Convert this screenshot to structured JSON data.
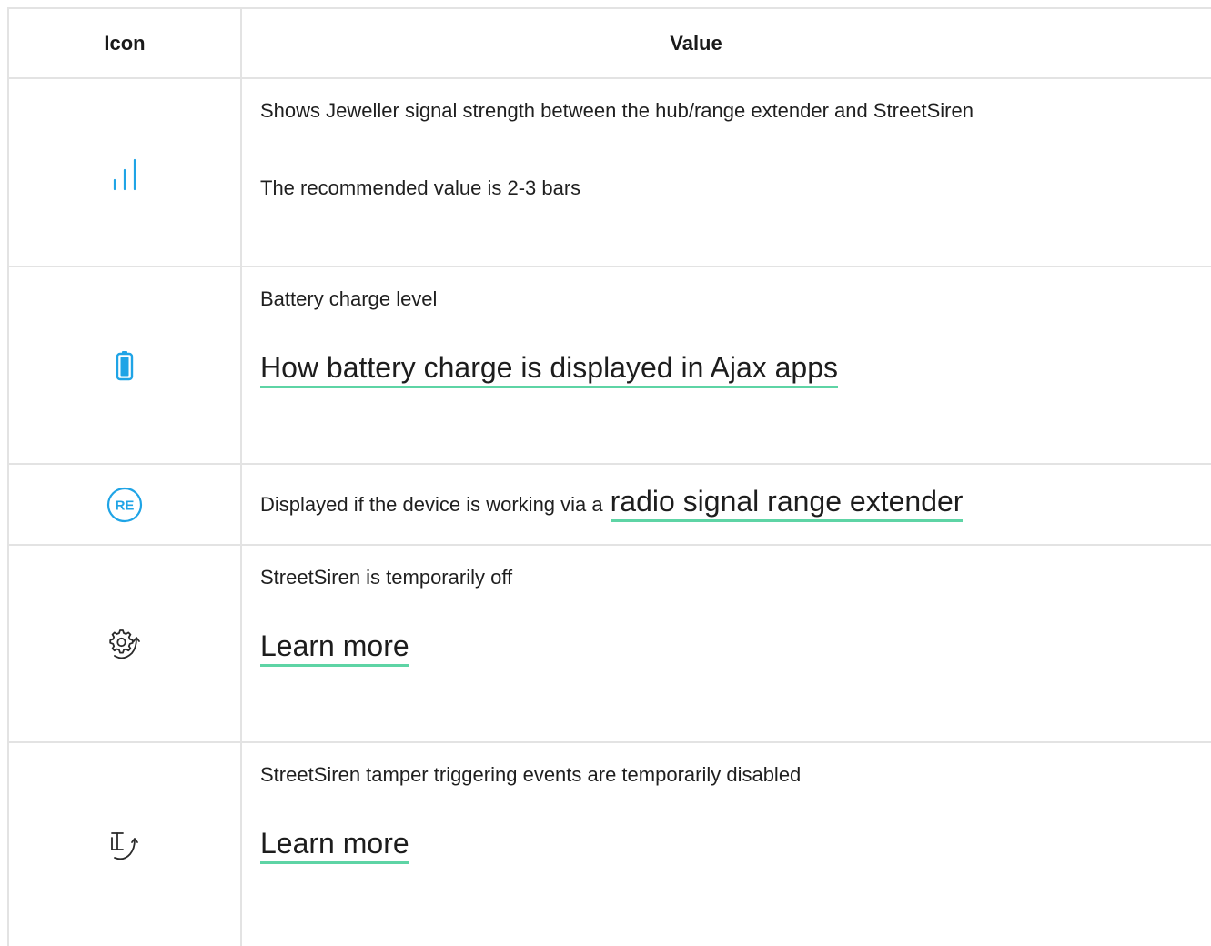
{
  "table": {
    "header": {
      "icon": "Icon",
      "value": "Value"
    },
    "rows": [
      {
        "icon": "signal-strength-icon",
        "icon_color": "#1fa4e6",
        "lines": [
          "Shows Jeweller signal strength between the hub/range extender and StreetSiren",
          "The recommended value is 2-3 bars"
        ]
      },
      {
        "icon": "battery-icon",
        "icon_color": "#1fa4e6",
        "text": "Battery charge level",
        "link": "How battery charge is displayed in Ajax apps"
      },
      {
        "icon": "range-extender-icon",
        "icon_text": "RE",
        "icon_color": "#1fa4e6",
        "text": "Displayed if the device is working via a",
        "link": "radio signal range extender"
      },
      {
        "icon": "temporarily-off-gear-icon",
        "icon_color": "#2a2a2a",
        "text": "StreetSiren is temporarily off",
        "link": "Learn more"
      },
      {
        "icon": "tamper-disabled-icon",
        "icon_color": "#2a2a2a",
        "text": "StreetSiren tamper triggering events are temporarily disabled",
        "link": "Learn more"
      }
    ]
  },
  "colors": {
    "border": "#e3e3e3",
    "link_underline": "#5ed4a5",
    "accent": "#1fa4e6"
  }
}
